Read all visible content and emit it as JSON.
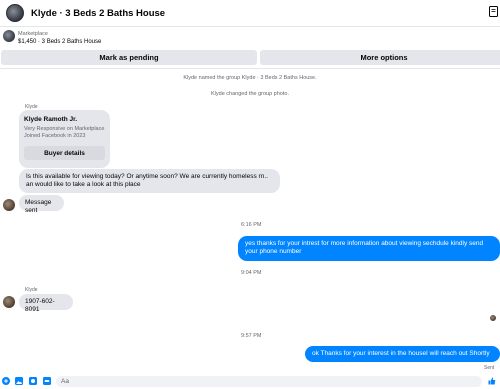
{
  "header": {
    "title": "Klyde · 3 Beds 2 Baths House"
  },
  "listing": {
    "source": "Marketplace",
    "item": "$1,450 · 3 Beds 2 Baths House"
  },
  "actions": {
    "pending_label": "Mark as pending",
    "more_label": "More options"
  },
  "system_messages": [
    "Klyde named the group Klyde · 3 Beds 2 Baths House.",
    "Klyde changed the group photo."
  ],
  "card": {
    "sender": "Klyde",
    "name": "Klyde Ramoth Jr.",
    "meta1": "Very Responsive on Marketplace",
    "meta2": "Joined Facebook in 2023",
    "button_label": "Buyer details"
  },
  "messages": {
    "in_1_line1": "Is this available for viewing today? Or anytime soon? We are currently homeless rn..",
    "in_1_line2": "an would like to take a look at this place",
    "in_2": "Message sent",
    "time_1": "6:16 PM",
    "out_1_line1": "yes thanks for your intrest for more information about viewing sechdule kindly send",
    "out_1_line2": "your phone number",
    "time_2": "9:04 PM",
    "sender_2": "Klyde",
    "in_3": "1907-602-8091",
    "time_3": "9:57 PM",
    "out_2": "ok Thanks for your interest in the houseI will reach out Shortly",
    "status": "Sent"
  },
  "composer": {
    "placeholder": "Aa"
  },
  "colors": {
    "accent": "#0084ff",
    "bubble_in": "#e4e6eb"
  }
}
